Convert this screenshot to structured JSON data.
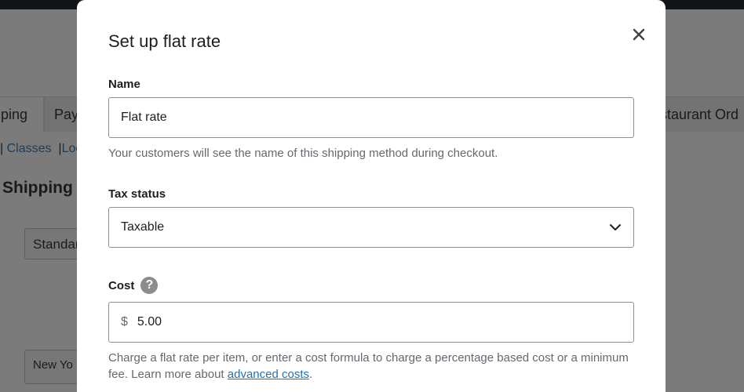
{
  "background": {
    "tabs": [
      "ping",
      "Pay",
      "staurant Ord"
    ],
    "sublinks": [
      "Classes",
      "Loc"
    ],
    "heading": "Shipping -",
    "boxes": [
      "Standar",
      "New Yo"
    ]
  },
  "modal": {
    "title": "Set up flat rate",
    "name": {
      "label": "Name",
      "value": "Flat rate",
      "help": "Your customers will see the name of this shipping method during checkout."
    },
    "tax_status": {
      "label": "Tax status",
      "selected": "Taxable"
    },
    "cost": {
      "label": "Cost",
      "help_icon": "?",
      "currency": "$",
      "value": "5.00",
      "help_prefix": "Charge a flat rate per item, or enter a cost formula to charge a percentage based cost or a minimum fee. Learn more about ",
      "help_link": "advanced costs",
      "help_suffix": "."
    }
  },
  "icons": {
    "close": "close-icon",
    "dropdown": "chevron-down-icon",
    "help": "help-circle-icon"
  },
  "colors": {
    "link": "#2271b1",
    "help_text": "#646970",
    "border": "#8c8f94",
    "overlay": "#7b7b7b"
  }
}
